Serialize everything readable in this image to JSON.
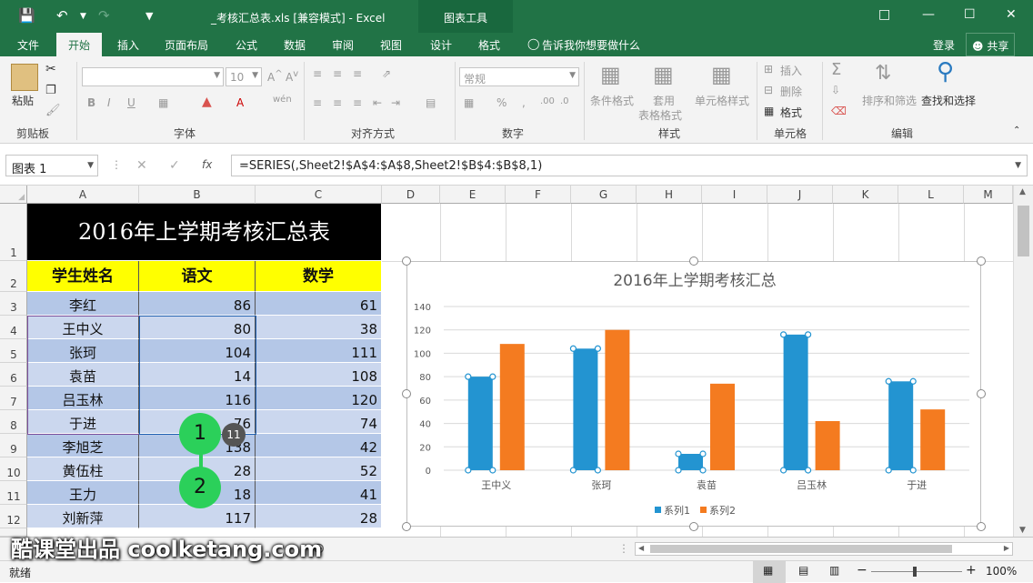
{
  "window": {
    "title": "_考核汇总表.xls  [兼容模式] - Excel",
    "chart_tools": "图表工具",
    "login": "登录",
    "share": "共享"
  },
  "tabs": [
    "文件",
    "开始",
    "插入",
    "页面布局",
    "公式",
    "数据",
    "审阅",
    "视图",
    "设计",
    "格式"
  ],
  "tell_me": "告诉我你想要做什么",
  "ribbon": {
    "paste": "粘贴",
    "clipboard": "剪贴板",
    "font": "字体",
    "font_size": "10",
    "alignment": "对齐方式",
    "number_format": "常规",
    "number": "数字",
    "cond_format": "条件格式",
    "table_format_1": "套用",
    "table_format_2": "表格格式",
    "cell_style": "单元格样式",
    "styles": "样式",
    "insert": "插入",
    "delete": "删除",
    "format": "格式",
    "cells": "单元格",
    "sort_filter": "排序和筛选",
    "find_select": "查找和选择",
    "editing": "编辑"
  },
  "formula_bar": {
    "name_box": "图表 1",
    "fx": "fx",
    "formula": "=SERIES(,Sheet2!$A$4:$A$8,Sheet2!$B$4:$B$8,1)"
  },
  "columns": [
    "A",
    "B",
    "C",
    "D",
    "E",
    "F",
    "G",
    "H",
    "I",
    "J",
    "K",
    "L",
    "M"
  ],
  "rows": [
    "1",
    "2",
    "3",
    "4",
    "5",
    "6",
    "7",
    "8",
    "9",
    "10",
    "11",
    "12"
  ],
  "sheet": {
    "title": "2016年上学期考核汇总表",
    "headers": [
      "学生姓名",
      "语文",
      "数学"
    ],
    "records": [
      [
        "李红",
        "86",
        "61"
      ],
      [
        "王中义",
        "80",
        "38"
      ],
      [
        "张珂",
        "104",
        "111"
      ],
      [
        "袁苗",
        "14",
        "108"
      ],
      [
        "吕玉林",
        "116",
        "120"
      ],
      [
        "于进",
        "76",
        "74"
      ],
      [
        "李旭芝",
        "138",
        "42"
      ],
      [
        "黄伍柱",
        "28",
        "52"
      ],
      [
        "王力",
        "18",
        "41"
      ],
      [
        "刘新萍",
        "117",
        "28"
      ]
    ]
  },
  "chart_data": {
    "type": "bar",
    "title": "2016年上学期考核汇总",
    "categories": [
      "王中义",
      "张珂",
      "袁苗",
      "吕玉林",
      "于进"
    ],
    "series": [
      {
        "name": "系列1",
        "values": [
          80,
          104,
          14,
          116,
          76
        ],
        "color": "#2394d1"
      },
      {
        "name": "系列2",
        "values": [
          108,
          120,
          74,
          42,
          52
        ],
        "color": "#f47b20"
      }
    ],
    "ylim": [
      0,
      140
    ],
    "yticks": [
      "0",
      "20",
      "40",
      "60",
      "80",
      "100",
      "120",
      "140"
    ],
    "grid": true,
    "legend": "bottom"
  },
  "status": {
    "ready": "就绪",
    "zoom": "100%"
  },
  "overlay": {
    "step1": "1",
    "step2": "2",
    "badge": "11",
    "watermark": "酷课堂出品 coolketang.com"
  }
}
